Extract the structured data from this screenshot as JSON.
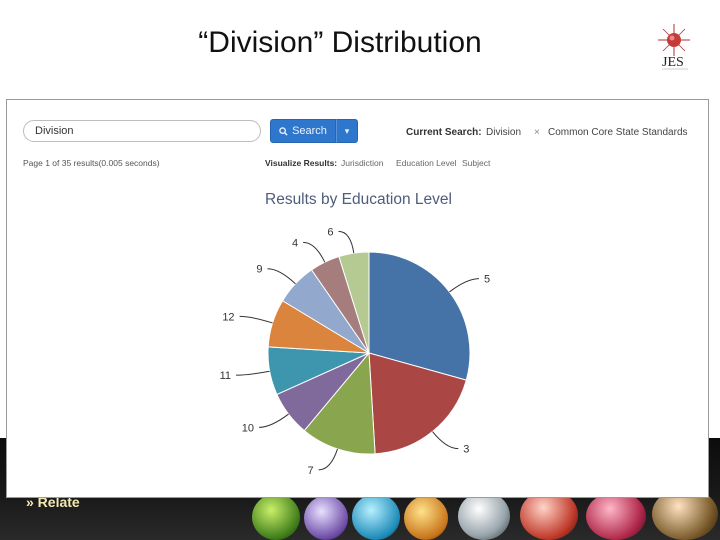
{
  "slide": {
    "title": "“Division” Distribution",
    "bottom_link": "» Relate",
    "logo_text": "JES"
  },
  "search": {
    "query": "Division",
    "button_label": "Search",
    "current_label": "Current Search:",
    "current_term": "Division",
    "remove_glyph": "×",
    "current_standard": "Common Core State Standards"
  },
  "results": {
    "page_info": "Page 1 of 35 results(0.005 seconds)",
    "visualize_label": "Visualize Results:",
    "visualize_options": [
      "Jurisdiction",
      "Education Level",
      "Subject"
    ]
  },
  "chart_data": {
    "type": "pie",
    "title": "Results by Education Level",
    "slices": [
      {
        "label": "5",
        "value": 30.5,
        "color": "#4572a7"
      },
      {
        "label": "3",
        "value": 20.5,
        "color": "#aa4643"
      },
      {
        "label": "7",
        "value": 12.5,
        "color": "#89a54e"
      },
      {
        "label": "10",
        "value": 7.5,
        "color": "#80699b"
      },
      {
        "label": "11",
        "value": 8.0,
        "color": "#3d96ae"
      },
      {
        "label": "12",
        "value": 8.0,
        "color": "#db843d"
      },
      {
        "label": "9",
        "value": 7.0,
        "color": "#92a8cd"
      },
      {
        "label": "4",
        "value": 5.0,
        "color": "#a47d7c"
      },
      {
        "label": "6",
        "value": 5.0,
        "color": "#b5ca92"
      }
    ]
  },
  "colors": {
    "accent": "#2f77cc",
    "title_text": "#4d5d7a"
  }
}
